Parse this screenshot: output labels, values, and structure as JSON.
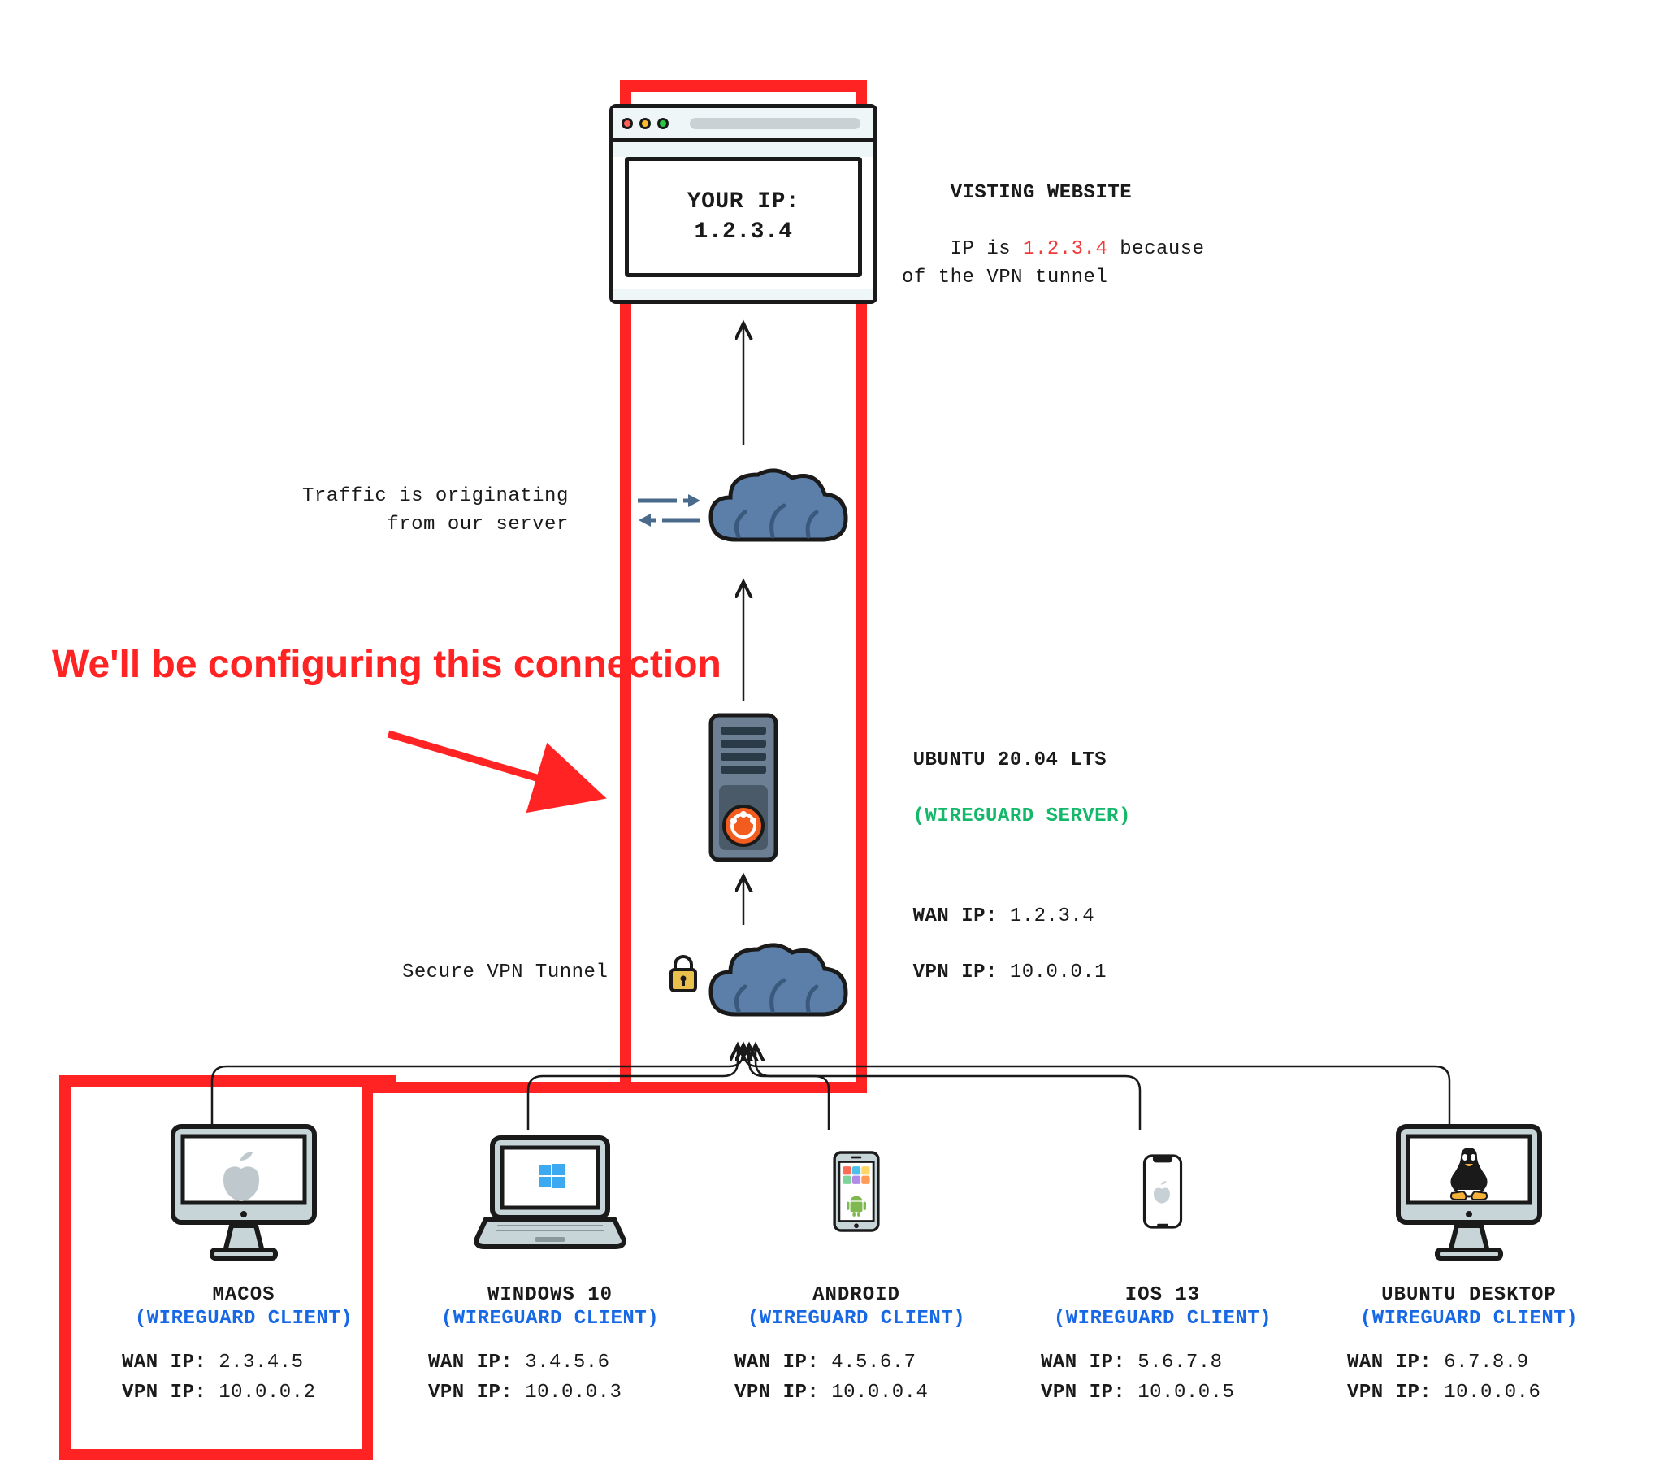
{
  "browser": {
    "line1": "YOUR IP:",
    "line2": "1.2.3.4"
  },
  "website_label": {
    "title": "VISTING WEBSITE",
    "text_prefix": "IP is ",
    "ip": "1.2.3.4",
    "text_suffix": " because\nof the VPN tunnel"
  },
  "traffic_label": "Traffic is originating\nfrom our server",
  "tunnel_label": "Secure VPN Tunnel",
  "annotation": "We'll be configuring\nthis connection",
  "server": {
    "title": "UBUNTU 20.04 LTS",
    "role": "(WIREGUARD SERVER)",
    "wan_label": "WAN IP:",
    "wan_ip": "1.2.3.4",
    "vpn_label": "VPN IP:",
    "vpn_ip": "10.0.0.1"
  },
  "clients": [
    {
      "title": "MACOS",
      "role": "(WIREGUARD CLIENT)",
      "wan": "2.3.4.5",
      "vpn": "10.0.0.2"
    },
    {
      "title": "WINDOWS 10",
      "role": "(WIREGUARD CLIENT)",
      "wan": "3.4.5.6",
      "vpn": "10.0.0.3"
    },
    {
      "title": "ANDROID",
      "role": "(WIREGUARD CLIENT)",
      "wan": "4.5.6.7",
      "vpn": "10.0.0.4"
    },
    {
      "title": "IOS 13",
      "role": "(WIREGUARD CLIENT)",
      "wan": "5.6.7.8",
      "vpn": "10.0.0.5"
    },
    {
      "title": "UBUNTU DESKTOP",
      "role": "(WIREGUARD CLIENT)",
      "wan": "6.7.8.9",
      "vpn": "10.0.0.6"
    }
  ],
  "ip_labels": {
    "wan": "WAN IP:",
    "vpn": "VPN IP:"
  },
  "colors": {
    "red": "#ff2323",
    "outline": "#1a1a1a",
    "green": "#14b86a",
    "blue": "#1768e5",
    "cloud": "#5b7fa8",
    "cloud_dark": "#3a5a7d"
  }
}
